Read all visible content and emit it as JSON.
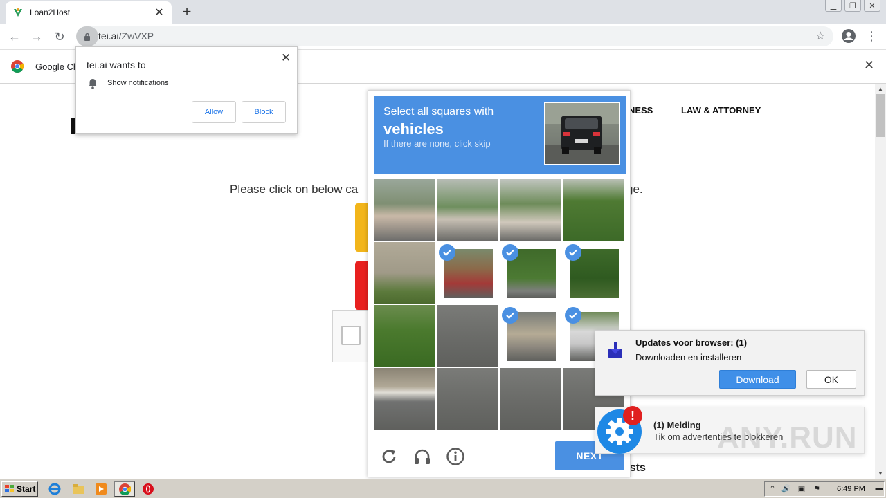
{
  "browser": {
    "tab_title": "Loan2Host",
    "url_host": "tei.ai",
    "url_path": "/ZwVXP",
    "infobar_text": "Google Ch"
  },
  "page": {
    "nav": [
      "TNESS",
      "LAW & ATTORNEY"
    ],
    "instruction_start": "Please click on below ca",
    "instruction_end": "ge.",
    "posts_text": "osts"
  },
  "permission_popup": {
    "title": "tei.ai wants to",
    "item": "Show notifications",
    "allow_label": "Allow",
    "block_label": "Block"
  },
  "captcha": {
    "line1": "Select all squares with",
    "target": "vehicles",
    "line3": "If there are none, click skip",
    "next_label": "NEXT",
    "tiles": [
      {
        "scene": "trees-house",
        "selected": false
      },
      {
        "scene": "house-tower",
        "selected": false
      },
      {
        "scene": "house-trees",
        "selected": false
      },
      {
        "scene": "trees",
        "selected": false
      },
      {
        "scene": "field",
        "selected": false
      },
      {
        "scene": "car-sign",
        "selected": true
      },
      {
        "scene": "bush-car",
        "selected": true
      },
      {
        "scene": "tree",
        "selected": true
      },
      {
        "scene": "bushes",
        "selected": false
      },
      {
        "scene": "road",
        "selected": false
      },
      {
        "scene": "car",
        "selected": true
      },
      {
        "scene": "car-white",
        "selected": true
      },
      {
        "scene": "curb",
        "selected": false
      },
      {
        "scene": "road",
        "selected": false
      },
      {
        "scene": "road",
        "selected": false
      },
      {
        "scene": "road",
        "selected": false
      }
    ],
    "accent_color": "#4a90e2"
  },
  "update_popup": {
    "title": "Updates voor browser: (1)",
    "subtitle": "Downloaden en installeren",
    "download_label": "Download",
    "ok_label": "OK"
  },
  "melding": {
    "badge": "!",
    "title": "(1) Melding",
    "subtitle": "Tik om advertenties te blokkeren"
  },
  "watermark": "ANY.RUN",
  "taskbar": {
    "start_label": "Start",
    "clock": "6:49 PM"
  }
}
